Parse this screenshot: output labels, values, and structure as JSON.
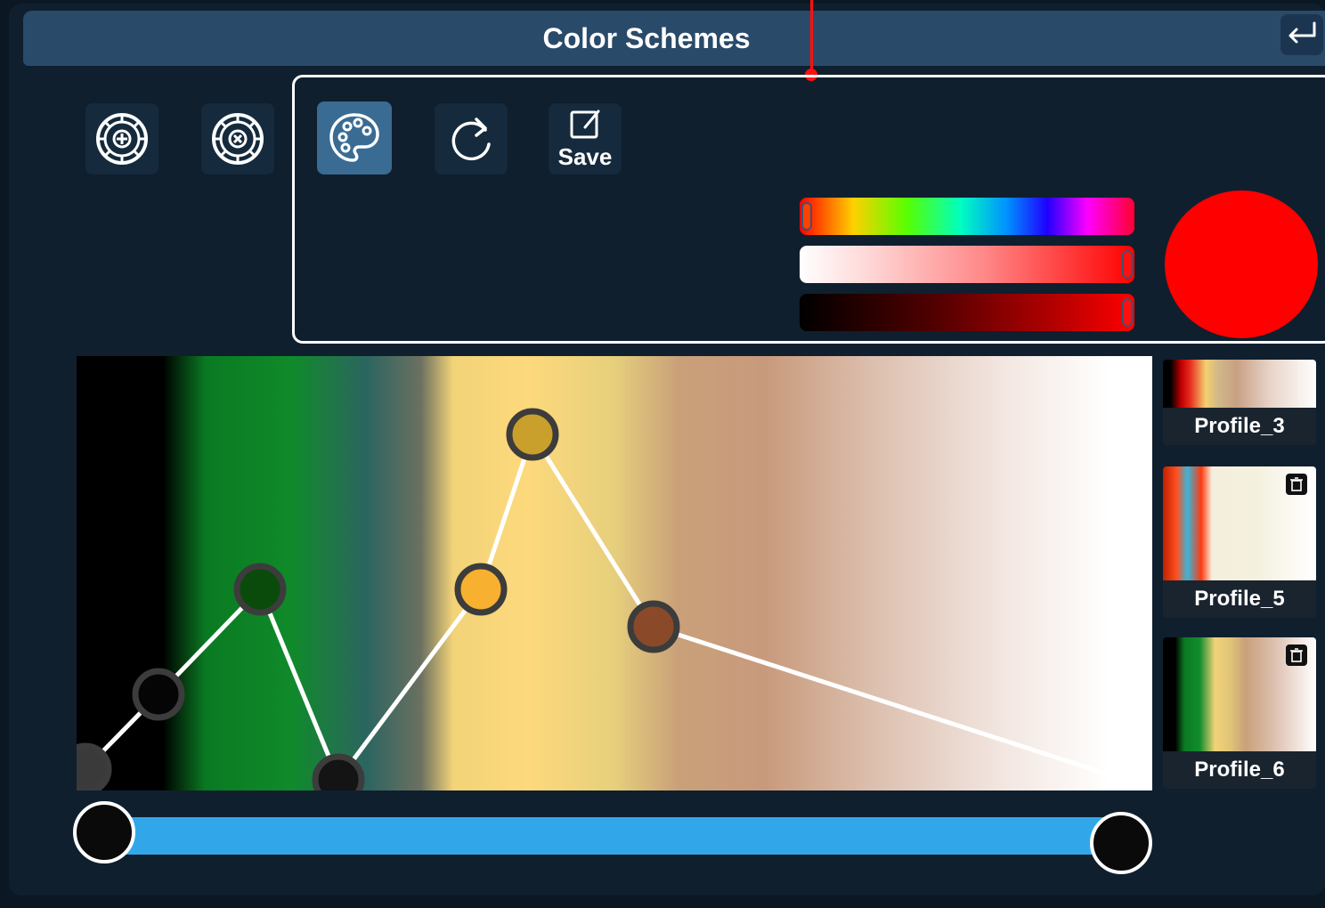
{
  "header": {
    "title": "Color Schemes"
  },
  "toolbar": {
    "save_label": "Save"
  },
  "picker": {
    "selected_color": "#ff0000"
  },
  "curve_points": [
    {
      "color": "#3a3a3a"
    },
    {
      "color": "#050505"
    },
    {
      "color": "#0a4a0a"
    },
    {
      "color": "#141414"
    },
    {
      "color": "#f8b030"
    },
    {
      "color": "#c9a02c"
    },
    {
      "color": "#8a4a2a"
    },
    {
      "color": "#ffffff"
    }
  ],
  "profiles": [
    {
      "label": "Profile_3",
      "deletable": false
    },
    {
      "label": "Profile_5",
      "deletable": true
    },
    {
      "label": "Profile_6",
      "deletable": true
    }
  ]
}
